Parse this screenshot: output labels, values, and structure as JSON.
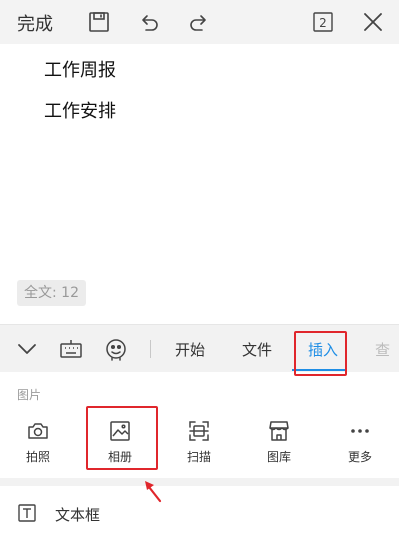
{
  "topbar": {
    "done_label": "完成",
    "save_icon": "save-icon",
    "undo_icon": "undo-icon",
    "redo_icon": "redo-icon",
    "page_count": "2",
    "close_icon": "close-icon"
  },
  "document": {
    "lines": [
      "工作周报",
      "工作安排"
    ],
    "word_count": "全文: 12"
  },
  "toolbar": {
    "collapse_icon": "chevron-down-icon",
    "keyboard_icon": "keyboard-icon",
    "voice_icon": "voice-assistant-icon",
    "tabs": [
      {
        "label": "开始",
        "active": false
      },
      {
        "label": "文件",
        "active": false
      },
      {
        "label": "插入",
        "active": true
      },
      {
        "label": "查",
        "active": false
      }
    ],
    "accent_color": "#1f8ee5",
    "highlight_color": "#e0262c"
  },
  "insert_panel": {
    "section_label": "图片",
    "items": [
      {
        "label": "拍照",
        "icon": "camera-icon"
      },
      {
        "label": "相册",
        "icon": "image-icon"
      },
      {
        "label": "扫描",
        "icon": "scan-icon"
      },
      {
        "label": "图库",
        "icon": "store-icon"
      },
      {
        "label": "更多",
        "icon": "more-icon"
      }
    ],
    "textbox_label": "文本框",
    "textbox_icon": "text-box-icon"
  }
}
